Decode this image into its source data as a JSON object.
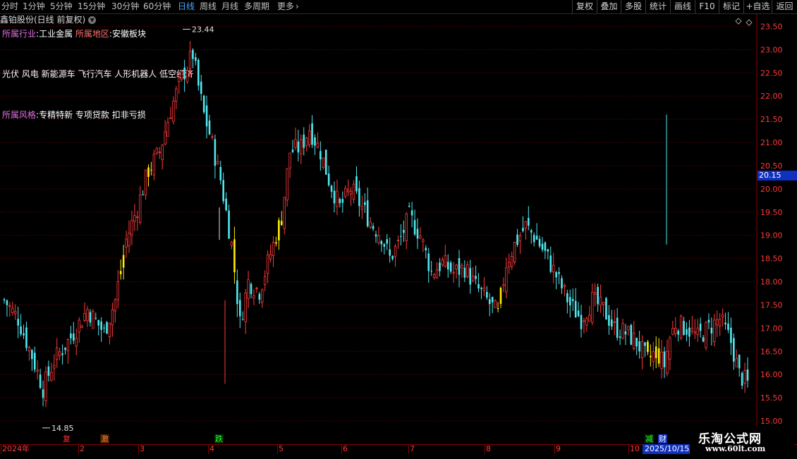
{
  "toolbar": {
    "periods": [
      "分时",
      "1分钟",
      "5分钟",
      "15分钟",
      "30分钟",
      "60分钟",
      "日线",
      "周线",
      "月线",
      "多周期",
      "更多"
    ],
    "active_period": "日线",
    "buttons": [
      "复权",
      "叠加",
      "多股",
      "统计",
      "画线",
      "F10",
      "标记",
      "+自选",
      "返回"
    ]
  },
  "stock_title": "鑫铂股份(日线 前复权)",
  "info": {
    "industry_label": "所属行业",
    "industry_value": "工业金属",
    "region_label": "所属地区",
    "region_value": "安徽板块",
    "concepts": "光伏 风电 新能源车 飞行汽车 人形机器人 低空经济",
    "style_label": "所属风格",
    "style_value": "专精特新 专项贷款 扣非亏损"
  },
  "months": [
    "2024年",
    "2",
    "3",
    "4",
    "5",
    "6",
    "7",
    "8",
    "9",
    "10"
  ],
  "current_date": "2025/10/15/三",
  "last_price": "20.15",
  "events": [
    {
      "text": "复",
      "color": "#ff3030",
      "bg": "#000000"
    },
    {
      "text": "激",
      "color": "#ff8030",
      "bg": "#3a1a00"
    },
    {
      "text": "跌",
      "color": "#30ff30",
      "bg": "#002a00"
    },
    {
      "text": "减",
      "color": "#30ff30",
      "bg": "#002a00"
    },
    {
      "text": "财",
      "color": "#ffffff",
      "bg": "#1030c0"
    }
  ],
  "watermark": {
    "title": "乐淘公式网",
    "url": "www.60lt.com"
  },
  "chart_data": {
    "type": "candlestick",
    "title": "鑫铂股份(日线 前复权)",
    "ylim": [
      15.0,
      23.6
    ],
    "yticks": [
      15.0,
      15.5,
      16.0,
      16.5,
      17.0,
      17.5,
      18.0,
      18.5,
      19.0,
      19.5,
      20.0,
      20.5,
      21.0,
      21.5,
      22.0,
      22.5,
      23.0,
      23.5
    ],
    "max_annotation": {
      "label": "23.44",
      "value": 23.44
    },
    "min_annotation": {
      "label": "14.85",
      "value": 14.85
    },
    "up_color": "#ff3a3a",
    "down_color": "#50e8f0",
    "highlight_color": "#ffee00",
    "anchors": [
      [
        0,
        17.6
      ],
      [
        5,
        17.2
      ],
      [
        10,
        16.4
      ],
      [
        14,
        15.7
      ],
      [
        18,
        16.3
      ],
      [
        24,
        16.8
      ],
      [
        30,
        17.4
      ],
      [
        36,
        16.9
      ],
      [
        40,
        17.6
      ],
      [
        44,
        18.9
      ],
      [
        48,
        19.6
      ],
      [
        52,
        20.4
      ],
      [
        56,
        20.8
      ],
      [
        60,
        21.7
      ],
      [
        64,
        22.4
      ],
      [
        68,
        22.9
      ],
      [
        70,
        22.2
      ],
      [
        72,
        21.6
      ],
      [
        74,
        21.2
      ],
      [
        78,
        20.2
      ],
      [
        82,
        18.8
      ],
      [
        85,
        17.1
      ],
      [
        88,
        18.0
      ],
      [
        92,
        17.8
      ],
      [
        96,
        18.6
      ],
      [
        100,
        19.4
      ],
      [
        103,
        20.8
      ],
      [
        107,
        20.9
      ],
      [
        110,
        21.3
      ],
      [
        114,
        20.8
      ],
      [
        117,
        20.2
      ],
      [
        121,
        19.6
      ],
      [
        125,
        20.0
      ],
      [
        129,
        19.6
      ],
      [
        133,
        19.2
      ],
      [
        136,
        19.0
      ],
      [
        139,
        18.5
      ],
      [
        142,
        18.8
      ],
      [
        146,
        19.4
      ],
      [
        150,
        19.0
      ],
      [
        154,
        18.2
      ],
      [
        158,
        18.4
      ],
      [
        162,
        18.2
      ],
      [
        166,
        18.3
      ],
      [
        170,
        17.9
      ],
      [
        174,
        17.6
      ],
      [
        178,
        17.3
      ],
      [
        181,
        18.4
      ],
      [
        184,
        18.8
      ],
      [
        188,
        19.2
      ],
      [
        192,
        18.9
      ],
      [
        196,
        18.5
      ],
      [
        200,
        18.0
      ],
      [
        204,
        17.5
      ],
      [
        208,
        17.2
      ],
      [
        212,
        17.6
      ],
      [
        216,
        17.4
      ],
      [
        220,
        17.0
      ],
      [
        224,
        16.9
      ],
      [
        228,
        16.7
      ],
      [
        232,
        16.3
      ],
      [
        235,
        16.5
      ],
      [
        238,
        16.2
      ],
      [
        240,
        16.8
      ],
      [
        242,
        17.1
      ],
      [
        246,
        17.0
      ],
      [
        250,
        16.8
      ],
      [
        254,
        17.0
      ],
      [
        258,
        17.2
      ],
      [
        262,
        16.7
      ],
      [
        265,
        16.0
      ],
      [
        268,
        15.8
      ]
    ],
    "highlight_days": [
      42,
      43,
      52,
      53,
      83,
      98,
      99,
      100,
      178,
      179,
      232,
      233,
      235,
      236
    ]
  }
}
